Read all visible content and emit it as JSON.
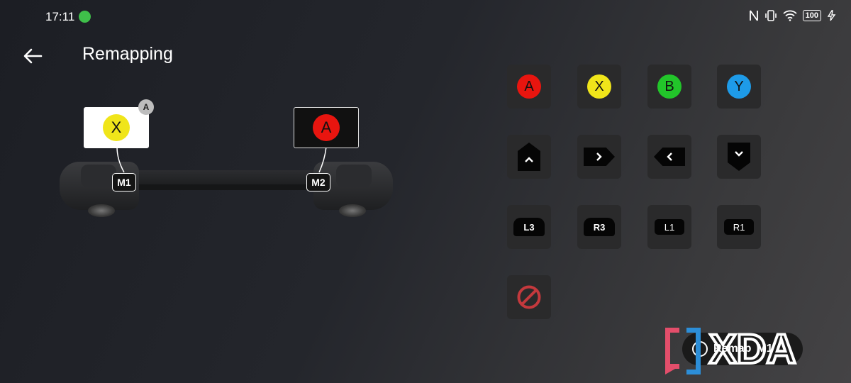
{
  "status": {
    "time": "17:11",
    "battery": "100"
  },
  "header": {
    "title": "Remapping"
  },
  "mappings": [
    {
      "key": "M1",
      "target": "X",
      "target_color": "#f0e51a",
      "card": "white",
      "badge": "A"
    },
    {
      "key": "M2",
      "target": "A",
      "target_color": "#e8150f",
      "card": "dark"
    }
  ],
  "face_buttons": [
    {
      "label": "A",
      "color": "#e8150f"
    },
    {
      "label": "X",
      "color": "#f0e51a"
    },
    {
      "label": "B",
      "color": "#22c52a"
    },
    {
      "label": "Y",
      "color": "#1e9be8"
    }
  ],
  "dpad": [
    "up",
    "right",
    "left",
    "down"
  ],
  "shoulders": [
    "L3",
    "R3",
    "L1",
    "R1"
  ],
  "clear_icon": "prohibited-icon",
  "toast": {
    "text": "Remap",
    "key": "M1"
  },
  "watermark": "XDA"
}
